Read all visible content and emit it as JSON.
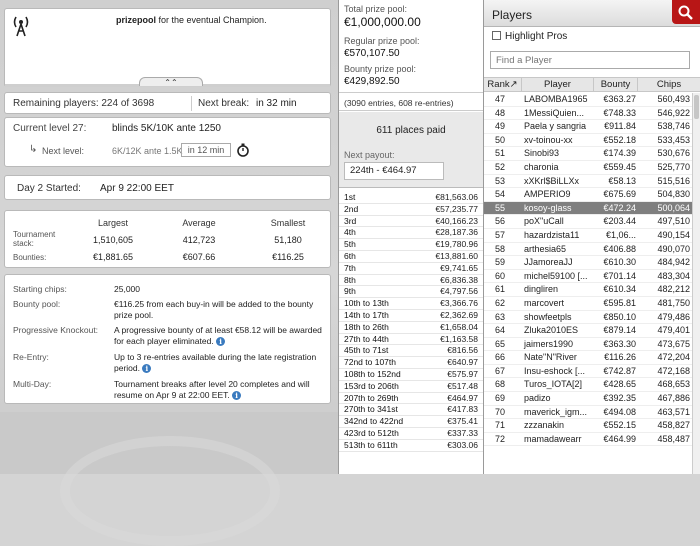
{
  "news": {
    "bold_text": "prizepool",
    "text": " for the eventual Champion.",
    "collapse_glyph": "⌃⌃"
  },
  "status": {
    "remaining_label": "Remaining players: 224 of 3698",
    "break_label": "Next break:",
    "break_value": "in 32 min"
  },
  "level": {
    "current_label": "Current level 27:",
    "current_value": "blinds 5K/10K ante 1250",
    "next_label": "Next level:",
    "next_value": "6K/12K ante 1.5K",
    "next_time": "in 12 min"
  },
  "day": {
    "label": "Day 2 Started:",
    "value": "Apr 9 22:00 EET"
  },
  "stats": {
    "headers": [
      "Largest",
      "Average",
      "Smallest"
    ],
    "stack_label": "Tournament stack:",
    "stack_values": [
      "1,510,605",
      "412,723",
      "51,180"
    ],
    "bounty_label": "Bounties:",
    "bounty_values": [
      "€1,881.65",
      "€607.66",
      "€116.25"
    ]
  },
  "info": {
    "starting_chips_label": "Starting chips:",
    "starting_chips_value": "25,000",
    "bounty_pool_label": "Bounty pool:",
    "bounty_pool_value": "€116.25 from each buy-in will be added to the bounty prize pool.",
    "pko_label": "Progressive Knockout:",
    "pko_value": "A progressive bounty of at least €58.12 will be awarded for each player eliminated.",
    "reentry_label": "Re-Entry:",
    "reentry_value": "Up to 3 re-entries available during the late registration period.",
    "multiday_label": "Multi-Day:",
    "multiday_value": "Tournament breaks after level 20 completes and will resume on Apr 9 at 22:00 EET."
  },
  "prize": {
    "total_label": "Total prize pool:",
    "total_value": "€1,000,000.00",
    "regular_label": "Regular prize pool:",
    "regular_value": "€570,107.50",
    "bounty_label": "Bounty prize pool:",
    "bounty_value": "€429,892.50",
    "entries": "(3090 entries, 608 re-entries)",
    "places_paid": "611 places paid",
    "next_payout_label": "Next payout:",
    "next_payout_value": "224th - €464.97",
    "payouts": [
      [
        "1st",
        "€81,563.06"
      ],
      [
        "2nd",
        "€57,235.77"
      ],
      [
        "3rd",
        "€40,166.23"
      ],
      [
        "4th",
        "€28,187.36"
      ],
      [
        "5th",
        "€19,780.96"
      ],
      [
        "6th",
        "€13,881.60"
      ],
      [
        "7th",
        "€9,741.65"
      ],
      [
        "8th",
        "€6,836.38"
      ],
      [
        "9th",
        "€4,797.56"
      ],
      [
        "10th to 13th",
        "€3,366.76"
      ],
      [
        "14th to 17th",
        "€2,362.69"
      ],
      [
        "18th to 26th",
        "€1,658.04"
      ],
      [
        "27th to 44th",
        "€1,163.58"
      ],
      [
        "45th to 71st",
        "€816.56"
      ],
      [
        "72nd to 107th",
        "€640.97"
      ],
      [
        "108th to 152nd",
        "€575.97"
      ],
      [
        "153rd to 206th",
        "€517.48"
      ],
      [
        "207th to 269th",
        "€464.97"
      ],
      [
        "270th to 341st",
        "€417.83"
      ],
      [
        "342nd to 422nd",
        "€375.41"
      ],
      [
        "423rd to 512th",
        "€337.33"
      ],
      [
        "513th to 611th",
        "€303.06"
      ]
    ]
  },
  "players": {
    "title": "Players",
    "highlight_label": "Highlight Pros",
    "search_placeholder": "Find a Player",
    "columns": [
      "Rank↗",
      "Player",
      "Bounty",
      "Chips"
    ],
    "selected_rank": "55",
    "rows": [
      [
        "47",
        "LABOMBA1965",
        "€363.27",
        "560,493"
      ],
      [
        "48",
        "1MessiQuien...",
        "€748.33",
        "546,922"
      ],
      [
        "49",
        "Paela y sangria",
        "€911.84",
        "538,746"
      ],
      [
        "50",
        "xv-toinou-xx",
        "€552.18",
        "533,453"
      ],
      [
        "51",
        "Sinobi93",
        "€174.39",
        "530,676"
      ],
      [
        "52",
        "charonia",
        "€559.45",
        "525,770"
      ],
      [
        "53",
        "xXKrl$BiLLXx",
        "€58.13",
        "515,516"
      ],
      [
        "54",
        "AMPERIO9",
        "€675.69",
        "504,830"
      ],
      [
        "55",
        "kosoy-glass",
        "€472.24",
        "500,064"
      ],
      [
        "56",
        "poX\"uCall",
        "€203.44",
        "497,510"
      ],
      [
        "57",
        "hazardzista11",
        "€1,06...",
        "490,154"
      ],
      [
        "58",
        "arthesia65",
        "€406.88",
        "490,070"
      ],
      [
        "59",
        "JJamoreaJJ",
        "€610.30",
        "484,942"
      ],
      [
        "60",
        "michel59100 [...",
        "€701.14",
        "483,304"
      ],
      [
        "61",
        "dingliren",
        "€610.34",
        "482,212"
      ],
      [
        "62",
        "marcovert",
        "€595.81",
        "481,750"
      ],
      [
        "63",
        "showfeetpls",
        "€850.10",
        "479,486"
      ],
      [
        "64",
        "Zluka2010ES",
        "€879.14",
        "479,401"
      ],
      [
        "65",
        "jaimers1990",
        "€363.30",
        "473,675"
      ],
      [
        "66",
        "Nate\"N\"River",
        "€116.26",
        "472,204"
      ],
      [
        "67",
        "Insu-eshock [...",
        "€742.87",
        "472,168"
      ],
      [
        "68",
        "Turos_IOTA[2]",
        "€428.65",
        "468,653"
      ],
      [
        "69",
        "padizo",
        "€392.35",
        "467,886"
      ],
      [
        "70",
        "maverick_igm...",
        "€494.08",
        "463,571"
      ],
      [
        "71",
        "zzzanakin",
        "€552.15",
        "458,827"
      ],
      [
        "72",
        "mamadawearr",
        "€464.99",
        "458,487"
      ]
    ]
  }
}
